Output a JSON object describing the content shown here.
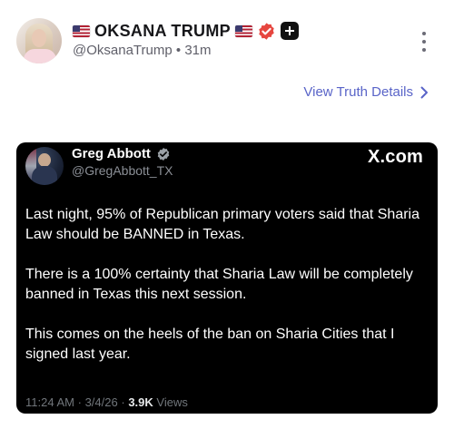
{
  "post": {
    "author": {
      "display_name": "OKSANA TRUMP",
      "handle": "@OksanaTrump",
      "separator": "•",
      "time_ago": "31m",
      "badges": [
        "us-flag-icon",
        "us-flag-icon",
        "verified-icon",
        "plus-icon"
      ]
    },
    "details_link": "View Truth Details",
    "colors": {
      "link": "#5964c8",
      "verified": "#e6463f",
      "card_background": "#000000"
    }
  },
  "embed": {
    "author_name": "Greg Abbott",
    "author_handle": "@GregAbbott_TX",
    "source": "X.com",
    "paragraphs": [
      "Last night, 95% of Republican primary voters said that Sharia Law should be BANNED in Texas.",
      "There is a 100% certainty that Sharia Law will be completely banned in Texas this next session.",
      "This comes on the heels of the ban on Sharia Cities that I signed last year."
    ],
    "footer": {
      "time": "11:24 AM",
      "dot1": "·",
      "date": "3/4/26",
      "dot2": "·",
      "views_count": "3.9K",
      "views_label": "Views"
    }
  }
}
